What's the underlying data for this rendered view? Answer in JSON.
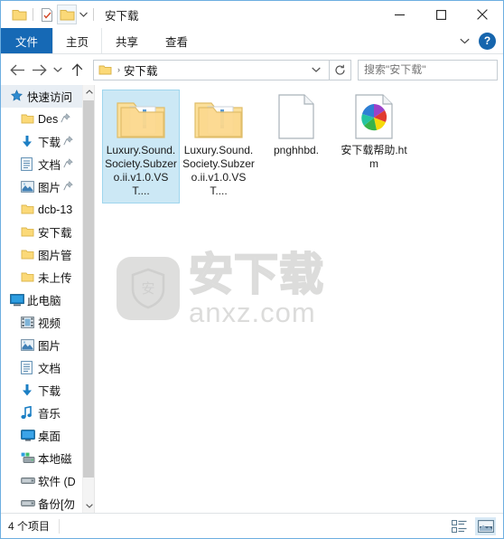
{
  "window": {
    "title": "安下载",
    "controls": {
      "minimize": "minimize-icon",
      "maximize": "maximize-icon",
      "close": "close-icon"
    }
  },
  "quick_access_toolbar": {
    "items": [
      {
        "name": "folder-icon",
        "label": ""
      },
      {
        "name": "properties-icon",
        "label": ""
      },
      {
        "name": "new-folder-icon",
        "label": ""
      },
      {
        "name": "customize-dropdown-icon",
        "label": "▾"
      }
    ]
  },
  "ribbon": {
    "tabs": [
      {
        "label": "文件",
        "selected": true
      },
      {
        "label": "主页",
        "selected": false
      },
      {
        "label": "共享",
        "selected": false
      },
      {
        "label": "查看",
        "selected": false
      }
    ],
    "collapse_icon": "chevron-down-icon",
    "help_label": "?"
  },
  "addressbar": {
    "back": "back-arrow-icon",
    "forward": "forward-arrow-icon",
    "recent": "chevron-down-icon",
    "up": "up-arrow-icon",
    "breadcrumb": {
      "folder_icon": "folder-icon",
      "separator": "›",
      "text": "安下载",
      "dropdown": "⌄"
    },
    "refresh": "refresh-icon"
  },
  "search": {
    "placeholder": "搜索\"安下载\"",
    "value": "",
    "icon": "search-icon"
  },
  "sidebar": {
    "items": [
      {
        "label": "快速访问",
        "icon": "pin-star-icon",
        "indent": 0,
        "selected": true,
        "pinned": false
      },
      {
        "label": "Des",
        "icon": "folder-icon",
        "indent": 1,
        "selected": false,
        "pinned": true
      },
      {
        "label": "下载",
        "icon": "download-icon",
        "indent": 1,
        "selected": false,
        "pinned": true
      },
      {
        "label": "文档",
        "icon": "documents-icon",
        "indent": 1,
        "selected": false,
        "pinned": true
      },
      {
        "label": "图片",
        "icon": "pictures-icon",
        "indent": 1,
        "selected": false,
        "pinned": true
      },
      {
        "label": "dcb-13",
        "icon": "folder-icon",
        "indent": 1,
        "selected": false,
        "pinned": false
      },
      {
        "label": "安下载",
        "icon": "folder-icon",
        "indent": 1,
        "selected": false,
        "pinned": false
      },
      {
        "label": "图片管",
        "icon": "folder-icon",
        "indent": 1,
        "selected": false,
        "pinned": false
      },
      {
        "label": "未上传",
        "icon": "folder-icon",
        "indent": 1,
        "selected": false,
        "pinned": false
      },
      {
        "label": "此电脑",
        "icon": "this-pc-icon",
        "indent": 0,
        "selected": false,
        "pinned": false
      },
      {
        "label": "视频",
        "icon": "videos-icon",
        "indent": 1,
        "selected": false,
        "pinned": false
      },
      {
        "label": "图片",
        "icon": "pictures-icon",
        "indent": 1,
        "selected": false,
        "pinned": false
      },
      {
        "label": "文档",
        "icon": "documents-icon",
        "indent": 1,
        "selected": false,
        "pinned": false
      },
      {
        "label": "下载",
        "icon": "download-icon",
        "indent": 1,
        "selected": false,
        "pinned": false
      },
      {
        "label": "音乐",
        "icon": "music-icon",
        "indent": 1,
        "selected": false,
        "pinned": false
      },
      {
        "label": "桌面",
        "icon": "desktop-icon",
        "indent": 1,
        "selected": false,
        "pinned": false
      },
      {
        "label": "本地磁",
        "icon": "local-disk-icon",
        "indent": 1,
        "selected": false,
        "pinned": false
      },
      {
        "label": "软件 (D",
        "icon": "drive-icon",
        "indent": 1,
        "selected": false,
        "pinned": false
      },
      {
        "label": "备份[勿",
        "icon": "drive-icon",
        "indent": 1,
        "selected": false,
        "pinned": false
      }
    ],
    "scrollbar": {
      "up": "▲",
      "down": "▼"
    }
  },
  "files": [
    {
      "name": "Luxury.Sound.Society.Subzero.ii.v1.0.VST....",
      "type": "folder",
      "icon": "folder-icon",
      "selected": true
    },
    {
      "name": "Luxury.Sound.Society.Subzero.ii.v1.0.VST....",
      "type": "folder",
      "icon": "folder-icon",
      "selected": false
    },
    {
      "name": "pnghhbd.",
      "type": "file",
      "icon": "blank-document-icon",
      "selected": false
    },
    {
      "name": "安下载帮助.htm",
      "type": "file",
      "icon": "html-pinwheel-icon",
      "selected": false
    }
  ],
  "watermark": {
    "badge_text": "安",
    "cn_text": "安下载",
    "en_text": "anxz.com"
  },
  "statusbar": {
    "item_count": "4 个项目",
    "views": [
      {
        "name": "details-view-button",
        "active": false
      },
      {
        "name": "large-icons-view-button",
        "active": true
      }
    ]
  },
  "colors": {
    "accent": "#1669b5",
    "selection": "#cce8f5",
    "border": "#6daee0",
    "folder": "#fbd978"
  }
}
